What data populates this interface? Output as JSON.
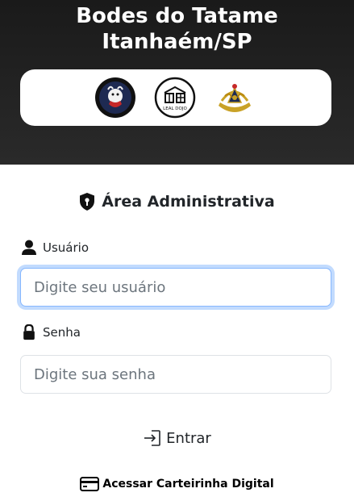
{
  "header": {
    "title_line1": "Bodes do Tatame",
    "title_line2": "Itanhaém/SP",
    "logos": [
      {
        "icon": "bodes-do-tatame-logo"
      },
      {
        "icon": "leal-dojo-logo",
        "text": "LEAL DOJO"
      },
      {
        "icon": "masonic-emblem-logo"
      }
    ]
  },
  "admin": {
    "title": "Área Administrativa",
    "icon": "shield-icon"
  },
  "form": {
    "user_label": "Usuário",
    "user_placeholder": "Digite seu usuário",
    "user_value": "",
    "pass_label": "Senha",
    "pass_placeholder": "Digite sua senha",
    "pass_value": "",
    "submit_label": "Entrar"
  },
  "footer": {
    "card_link_label": "Acessar Carteirinha Digital",
    "card_icon": "credit-card-icon"
  },
  "colors": {
    "header_bg": "#1a1a1a",
    "focus_border": "#86b7fe",
    "text": "#212529",
    "placeholder": "#6c757d"
  }
}
